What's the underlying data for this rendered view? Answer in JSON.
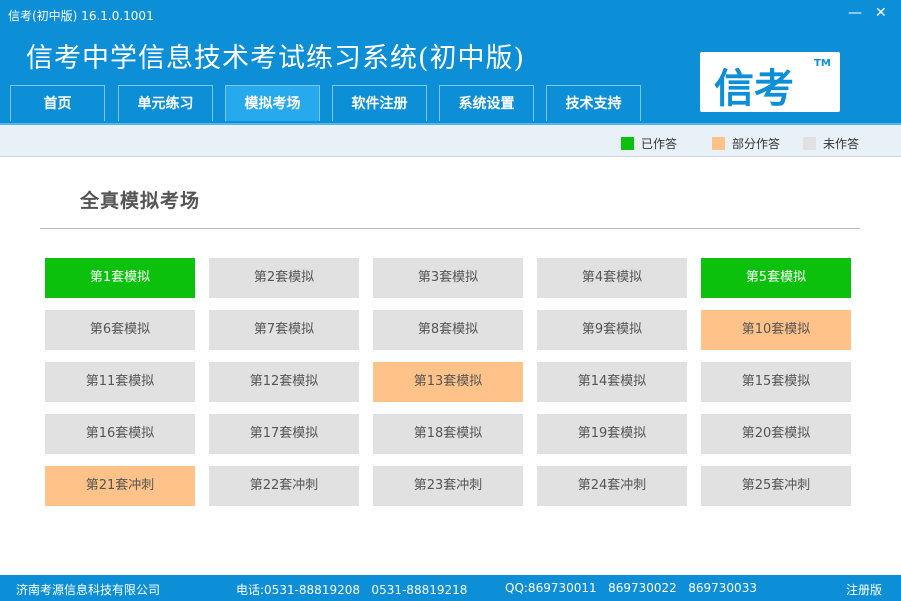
{
  "window": {
    "title": "信考(初中版) 16.1.0.1001",
    "minimize": "—",
    "close": "✕"
  },
  "header": {
    "app_title": "信考中学信息技术考试练习系统(初中版)",
    "logo_text": "信考",
    "logo_tm": "TM"
  },
  "tabs": [
    {
      "label": "首页",
      "active": false
    },
    {
      "label": "单元练习",
      "active": false
    },
    {
      "label": "模拟考场",
      "active": true
    },
    {
      "label": "软件注册",
      "active": false
    },
    {
      "label": "系统设置",
      "active": false
    },
    {
      "label": "技术支持",
      "active": false
    }
  ],
  "legend": [
    {
      "label": "已作答",
      "color": "#0cc10c"
    },
    {
      "label": "部分作答",
      "color": "#ffc38a"
    },
    {
      "label": "未作答",
      "color": "#e1e1e1"
    }
  ],
  "section": {
    "title": "全真模拟考场"
  },
  "exams": [
    {
      "label": "第1套模拟",
      "status": "done"
    },
    {
      "label": "第2套模拟",
      "status": "none"
    },
    {
      "label": "第3套模拟",
      "status": "none"
    },
    {
      "label": "第4套模拟",
      "status": "none"
    },
    {
      "label": "第5套模拟",
      "status": "done"
    },
    {
      "label": "第6套模拟",
      "status": "none"
    },
    {
      "label": "第7套模拟",
      "status": "none"
    },
    {
      "label": "第8套模拟",
      "status": "none"
    },
    {
      "label": "第9套模拟",
      "status": "none"
    },
    {
      "label": "第10套模拟",
      "status": "partial"
    },
    {
      "label": "第11套模拟",
      "status": "none"
    },
    {
      "label": "第12套模拟",
      "status": "none"
    },
    {
      "label": "第13套模拟",
      "status": "partial"
    },
    {
      "label": "第14套模拟",
      "status": "none"
    },
    {
      "label": "第15套模拟",
      "status": "none"
    },
    {
      "label": "第16套模拟",
      "status": "none"
    },
    {
      "label": "第17套模拟",
      "status": "none"
    },
    {
      "label": "第18套模拟",
      "status": "none"
    },
    {
      "label": "第19套模拟",
      "status": "none"
    },
    {
      "label": "第20套模拟",
      "status": "none"
    },
    {
      "label": "第21套冲刺",
      "status": "partial"
    },
    {
      "label": "第22套冲刺",
      "status": "none"
    },
    {
      "label": "第23套冲刺",
      "status": "none"
    },
    {
      "label": "第24套冲刺",
      "status": "none"
    },
    {
      "label": "第25套冲刺",
      "status": "none"
    }
  ],
  "status_bar": {
    "company": "济南考源信息科技有限公司",
    "phone": "电话:0531-88819208   0531-88819218",
    "qq": "QQ:869730011   869730022   869730033",
    "edition": "注册版"
  }
}
